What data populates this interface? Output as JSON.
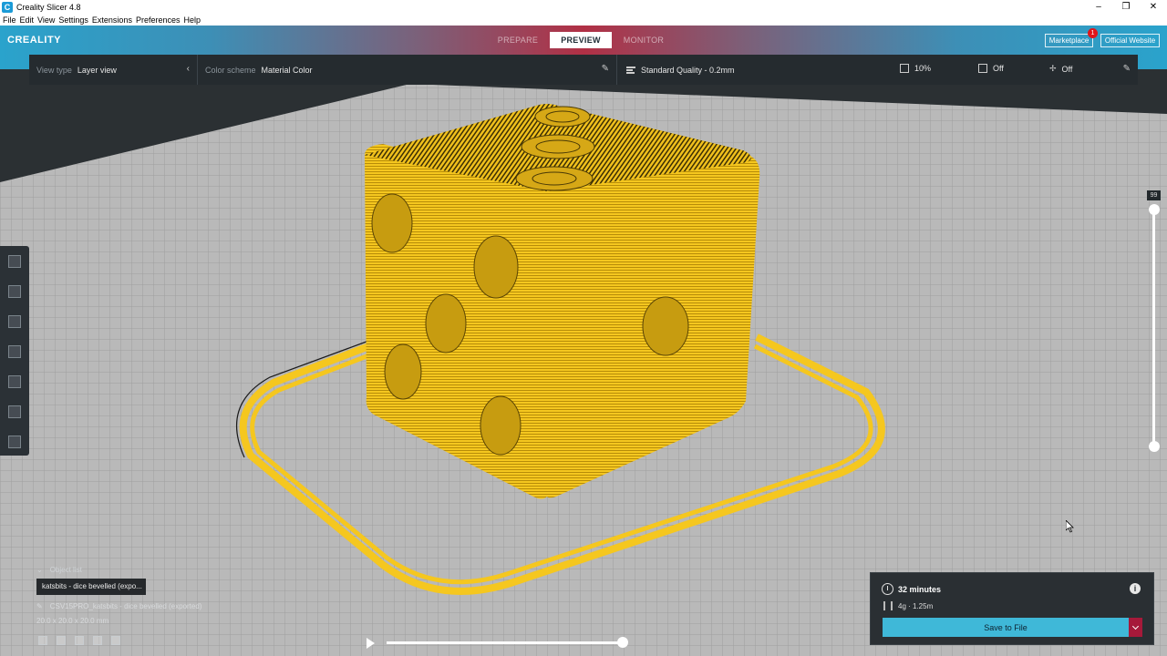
{
  "window": {
    "title": "Creality Slicer 4.8",
    "app_icon_letter": "C",
    "controls": {
      "minimize": "–",
      "maximize": "❐",
      "close": "✕"
    }
  },
  "menu": [
    "File",
    "Edit",
    "View",
    "Settings",
    "Extensions",
    "Preferences",
    "Help"
  ],
  "header": {
    "logo": "CREALITY",
    "stages": [
      {
        "label": "PREPARE",
        "active": false
      },
      {
        "label": "PREVIEW",
        "active": true
      },
      {
        "label": "MONITOR",
        "active": false
      }
    ],
    "marketplace_label": "Marketplace",
    "marketplace_badge": "1",
    "official_website_label": "Official Website"
  },
  "view_options": {
    "view_type_label": "View type",
    "view_type_value": "Layer view",
    "color_scheme_label": "Color scheme",
    "color_scheme_value": "Material Color"
  },
  "print_settings": {
    "quality": "Standard Quality - 0.2mm",
    "infill": "10%",
    "support": "Off",
    "adhesion": "Off"
  },
  "layer_slider": {
    "current_layer": "99"
  },
  "object_list": {
    "header": "Object list",
    "selected": "katsbits - dice bevelled (expo...",
    "file_name": "CSV15PRO_katsbits - dice bevelled (exported)",
    "dimensions": "20.0 x 20.0 x 20.0 mm"
  },
  "output": {
    "time": "32 minutes",
    "material": "4g · 1.25m",
    "save_label": "Save to File",
    "info_glyph": "i"
  },
  "colors": {
    "print": "#f4c51e",
    "accent": "#3fb8d8",
    "dropdown": "#a6193a",
    "panel": "#252b2f"
  }
}
